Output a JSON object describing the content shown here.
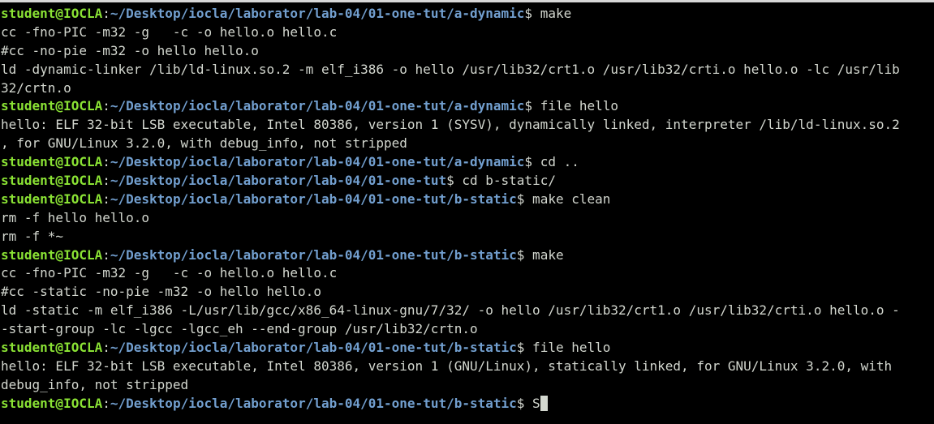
{
  "colors": {
    "background": "#000000",
    "user": "#8ae234",
    "path": "#729fcf",
    "text": "#d3d7cf",
    "cursor": "#d3d7cf"
  },
  "lines": [
    {
      "type": "prompt",
      "user": "student@IOCLA",
      "path": "~/Desktop/iocla/laborator/lab-04/01-one-tut/a-dynamic",
      "cmd": " make"
    },
    {
      "type": "output",
      "text": "cc -fno-PIC -m32 -g   -c -o hello.o hello.c"
    },
    {
      "type": "output",
      "text": "#cc -no-pie -m32 -o hello hello.o"
    },
    {
      "type": "output",
      "text": "ld -dynamic-linker /lib/ld-linux.so.2 -m elf_i386 -o hello /usr/lib32/crt1.o /usr/lib32/crti.o hello.o -lc /usr/lib"
    },
    {
      "type": "output",
      "text": "32/crtn.o"
    },
    {
      "type": "prompt",
      "user": "student@IOCLA",
      "path": "~/Desktop/iocla/laborator/lab-04/01-one-tut/a-dynamic",
      "cmd": " file hello"
    },
    {
      "type": "output",
      "text": "hello: ELF 32-bit LSB executable, Intel 80386, version 1 (SYSV), dynamically linked, interpreter /lib/ld-linux.so.2"
    },
    {
      "type": "output",
      "text": ", for GNU/Linux 3.2.0, with debug_info, not stripped"
    },
    {
      "type": "prompt",
      "user": "student@IOCLA",
      "path": "~/Desktop/iocla/laborator/lab-04/01-one-tut/a-dynamic",
      "cmd": " cd .."
    },
    {
      "type": "prompt",
      "user": "student@IOCLA",
      "path": "~/Desktop/iocla/laborator/lab-04/01-one-tut",
      "cmd": " cd b-static/"
    },
    {
      "type": "prompt",
      "user": "student@IOCLA",
      "path": "~/Desktop/iocla/laborator/lab-04/01-one-tut/b-static",
      "cmd": " make clean"
    },
    {
      "type": "output",
      "text": "rm -f hello hello.o"
    },
    {
      "type": "output",
      "text": "rm -f *~"
    },
    {
      "type": "prompt",
      "user": "student@IOCLA",
      "path": "~/Desktop/iocla/laborator/lab-04/01-one-tut/b-static",
      "cmd": " make"
    },
    {
      "type": "output",
      "text": "cc -fno-PIC -m32 -g   -c -o hello.o hello.c"
    },
    {
      "type": "output",
      "text": "#cc -static -no-pie -m32 -o hello hello.o"
    },
    {
      "type": "output",
      "text": "ld -static -m elf_i386 -L/usr/lib/gcc/x86_64-linux-gnu/7/32/ -o hello /usr/lib32/crt1.o /usr/lib32/crti.o hello.o -"
    },
    {
      "type": "output",
      "text": "-start-group -lc -lgcc -lgcc_eh --end-group /usr/lib32/crtn.o"
    },
    {
      "type": "prompt",
      "user": "student@IOCLA",
      "path": "~/Desktop/iocla/laborator/lab-04/01-one-tut/b-static",
      "cmd": " file hello"
    },
    {
      "type": "output",
      "text": "hello: ELF 32-bit LSB executable, Intel 80386, version 1 (GNU/Linux), statically linked, for GNU/Linux 3.2.0, with"
    },
    {
      "type": "output",
      "text": "debug_info, not stripped"
    },
    {
      "type": "prompt",
      "user": "student@IOCLA",
      "path": "~/Desktop/iocla/laborator/lab-04/01-one-tut/b-static",
      "cmd": " S",
      "cursor": true
    }
  ]
}
